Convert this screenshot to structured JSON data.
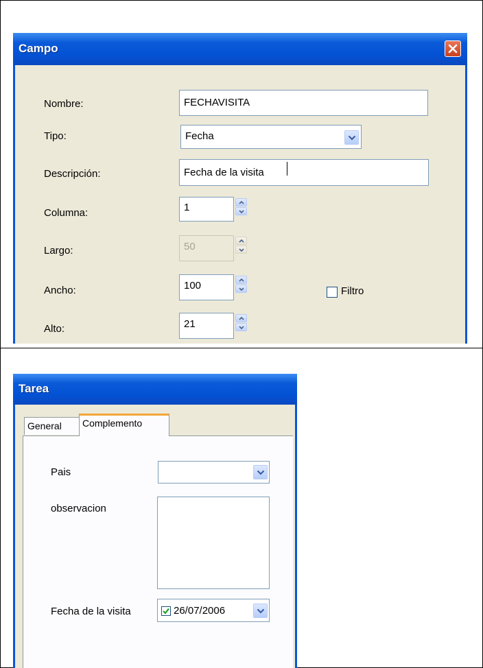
{
  "campo": {
    "title": "Campo",
    "fields": {
      "nombre": {
        "label": "Nombre:",
        "value": "FECHAVISITA"
      },
      "tipo": {
        "label": "Tipo:",
        "value": "Fecha"
      },
      "descripcion": {
        "label": "Descripción:",
        "value": "Fecha de la visita"
      },
      "columna": {
        "label": "Columna:",
        "value": "1"
      },
      "largo": {
        "label": "Largo:",
        "value": "50"
      },
      "ancho": {
        "label": "Ancho:",
        "value": "100"
      },
      "alto": {
        "label": "Alto:",
        "value": "21"
      }
    },
    "filtro": {
      "label": "Filtro",
      "checked": false
    }
  },
  "tarea": {
    "title": "Tarea",
    "tabs": [
      {
        "label": "General",
        "active": false
      },
      {
        "label": "Complemento",
        "active": true
      }
    ],
    "fields": {
      "pais": {
        "label": "Pais",
        "value": ""
      },
      "observacion": {
        "label": "observacion",
        "value": ""
      },
      "fecha": {
        "label": "Fecha de la visita",
        "value": "26/07/2006",
        "checked": true
      }
    }
  },
  "colors": {
    "titlebar": "#0452d4",
    "body": "#ece9d8",
    "input_border": "#7f9db9",
    "close": "#c8401d",
    "tab_highlight": "#f3a53a"
  }
}
